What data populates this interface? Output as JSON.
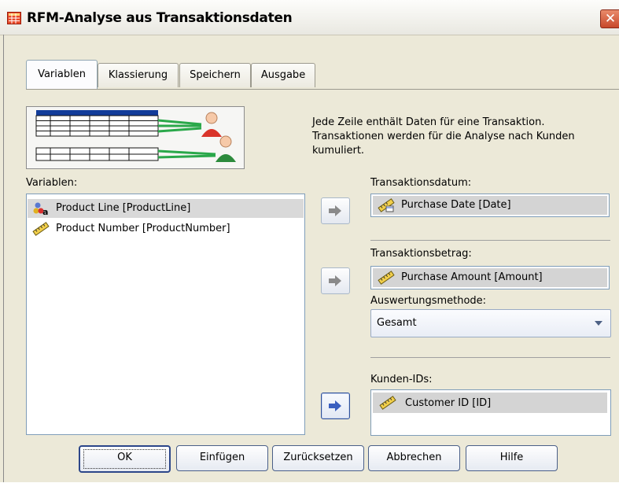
{
  "window": {
    "title": "RFM-Analyse aus Transaktionsdaten",
    "close_glyph": "✕"
  },
  "tabs": [
    {
      "label": "Variablen",
      "active": true
    },
    {
      "label": "Klassierung",
      "active": false
    },
    {
      "label": "Speichern",
      "active": false
    },
    {
      "label": "Ausgabe",
      "active": false
    }
  ],
  "description": "Jede Zeile enthält Daten für eine Transaktion. Transaktionen werden für die Analyse nach Kunden kumuliert.",
  "variables": {
    "label": "Variablen:",
    "items": [
      {
        "label": "Product Line [ProductLine]",
        "icon": "nominal-variable-icon",
        "selected": true
      },
      {
        "label": "Product Number [ProductNumber]",
        "icon": "scale-variable-icon",
        "selected": false
      }
    ]
  },
  "transaction_date": {
    "label": "Transaktionsdatum:",
    "value": "Purchase Date [Date]",
    "icon": "date-variable-icon"
  },
  "transaction_amount": {
    "label": "Transaktionsbetrag:",
    "value": "Purchase Amount [Amount]",
    "icon": "scale-variable-icon"
  },
  "summary_method": {
    "label": "Auswertungsmethode:",
    "value": "Gesamt"
  },
  "customer_ids": {
    "label": "Kunden-IDs:",
    "value": "Customer ID [ID]",
    "icon": "scale-variable-icon"
  },
  "buttons": {
    "ok": "OK",
    "paste": "Einfügen",
    "reset": "Zurücksetzen",
    "cancel": "Abbrechen",
    "help": "Hilfe"
  },
  "colors": {
    "dialog_background": "#ece9d8",
    "selection": "#d9d9d9",
    "arrow_blue": "#3b5fbf",
    "arrow_gray": "#8a8a8a"
  }
}
